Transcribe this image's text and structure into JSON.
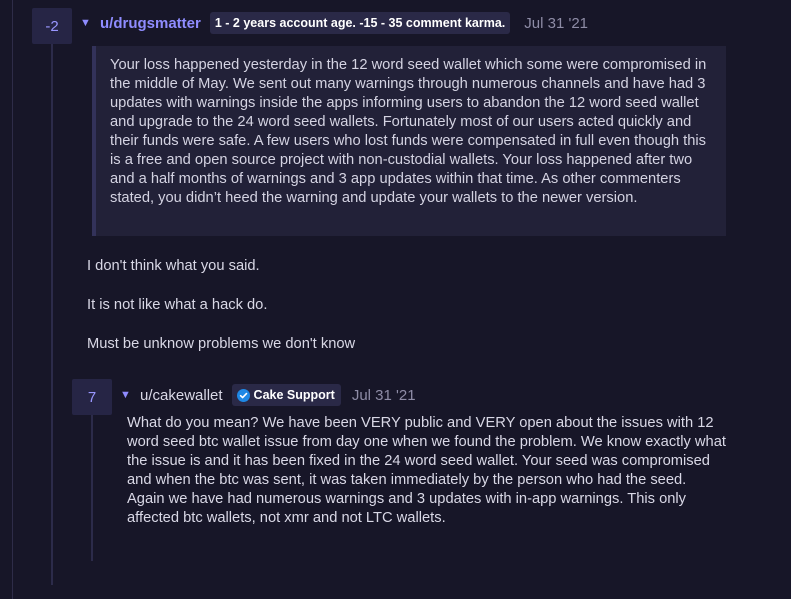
{
  "comment1": {
    "score": "-2",
    "collapse_icon": "caret-down-icon",
    "username": "u/drugsmatter",
    "flair": "1 - 2 years account age. -15 - 35 comment karma.",
    "timestamp": "Jul 31 '21",
    "quote": "Your loss happened yesterday in the 12 word seed wallet which some were compromised in the middle of May. We sent out many warnings through numerous channels and have had 3 updates with warnings inside the apps informing users to abandon the 12 word seed wallet and upgrade to the 24 word seed wallets. Fortunately most of our users acted quickly and their funds were safe. A few users who lost funds were compensated in full even though this is a free and open source project with non-custodial wallets. Your loss happened after two and a half months of warnings and 3 app updates within that time. As other commenters stated, you didn’t heed the warning and update your wallets to the newer version.",
    "paragraphs": [
      "I don't think what you said.",
      "It is not like what a hack do.",
      "Must be unknow problems we don't know"
    ]
  },
  "comment2": {
    "score": "7",
    "collapse_icon": "caret-down-icon",
    "username": "u/cakewallet",
    "flair_icon": "verified-check-icon",
    "flair": "Cake Support",
    "timestamp": "Jul 31 '21",
    "body": "What do you mean? We have been VERY public and VERY open about the issues with 12 word seed btc wallet issue from day one when we found the problem. We know exactly what the issue is and it has been fixed in the 24 word seed wallet. Your seed was compromised and when the btc was sent, it was taken immediately by the person who had the seed. Again we have had numerous warnings and 3 updates with in-app warnings. This only affected btc wallets, not xmr and not LTC wallets."
  },
  "colors": {
    "background": "#171628",
    "accent": "#8f8cff",
    "score_box": "#262545",
    "flair_bg": "#2a2947",
    "quote_bg": "#222138",
    "verified_blue": "#1e88e5"
  }
}
